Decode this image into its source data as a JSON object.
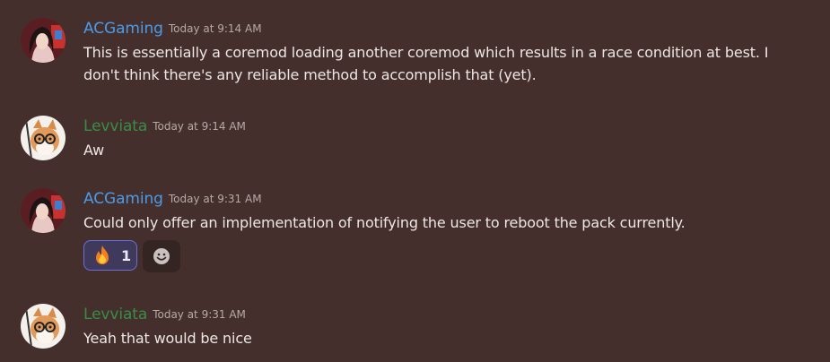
{
  "colors": {
    "background": "#442f2c",
    "acgaming_name": "#4b9be8",
    "levviata_name": "#3a8c47",
    "timestamp": "#b6aaa6",
    "reaction_border": "#6a6edc"
  },
  "messages": [
    {
      "username": "ACGaming",
      "timestamp": "Today at 9:14 AM",
      "avatar_icon": "anime-girl-avatar",
      "lines": [
        "This is essentially a coremod loading another coremod which results in a race condition at best. I",
        "don't think there's any reliable method to accomplish that (yet)."
      ]
    },
    {
      "username": "Levviata",
      "timestamp": "Today at 9:14 AM",
      "avatar_icon": "fox-glasses-avatar",
      "lines": [
        "Aw"
      ]
    },
    {
      "username": "ACGaming",
      "timestamp": "Today at 9:31 AM",
      "avatar_icon": "anime-girl-avatar",
      "lines": [
        "Could only offer an implementation of notifying the user to reboot the pack currently."
      ],
      "reactions": [
        {
          "emoji": "fire-emoji",
          "count": "1"
        }
      ],
      "add_reaction_icon": "smiley-plus-icon"
    },
    {
      "username": "Levviata",
      "timestamp": "Today at 9:31 AM",
      "avatar_icon": "fox-glasses-avatar",
      "lines": [
        "Yeah that would be nice"
      ]
    }
  ]
}
